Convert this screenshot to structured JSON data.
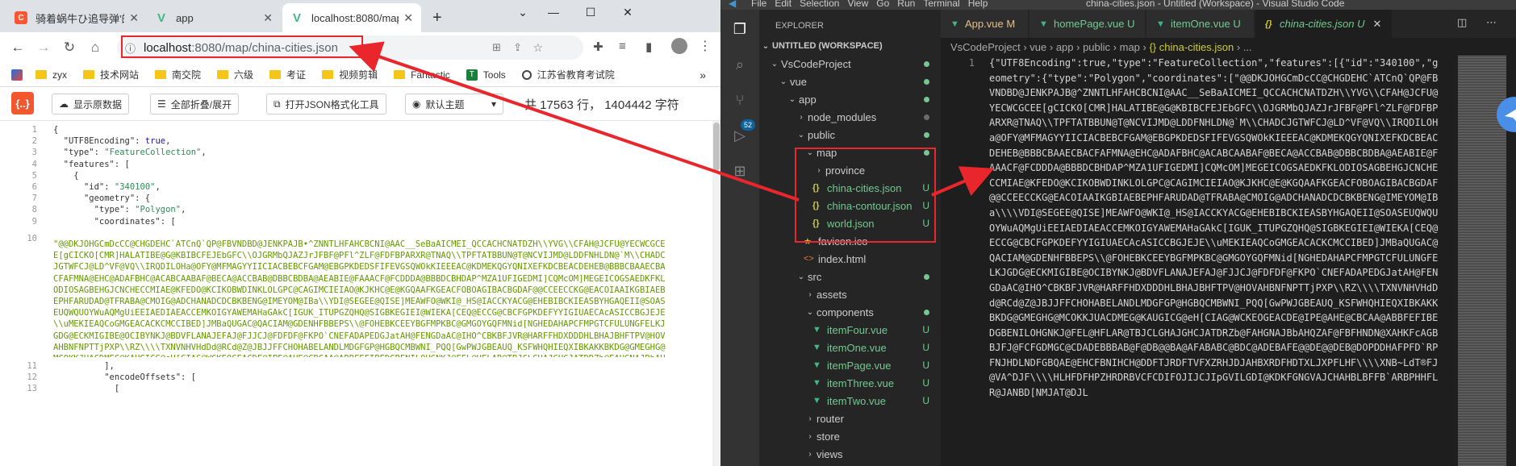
{
  "browser": {
    "tabs": [
      {
        "label": "骑着蜗牛ひ追导弹'的博客"
      },
      {
        "label": "app"
      },
      {
        "label": "localhost:8080/map/chin"
      }
    ],
    "new_tab": "+",
    "url": {
      "host": "localhost",
      "path": ":8080/map/china-cities.json"
    },
    "bookmarks": [
      "zyx",
      "技术网站",
      "南交院",
      "六级",
      "考证",
      "视频剪辑",
      "Fantastic",
      "Tools",
      "江苏省教育考试院"
    ],
    "more_bookmarks": "»",
    "colors": {
      "tabbar": "#dee1e6",
      "bookmark_folder": "#f5c518",
      "tool_logo": "#f2572d"
    }
  },
  "json_tool": {
    "logo": "{..}",
    "buttons": {
      "raw": "显示原数据",
      "fold": "全部折叠/展开",
      "format": "打开JSON格式化工具",
      "theme": "默认主题"
    },
    "stats": "共 17563 行， 1404442 字符"
  },
  "json_view": {
    "line_numbers": [
      "1",
      "2",
      "3",
      "4",
      "5",
      "6",
      "7",
      "8",
      "9",
      "10",
      "11",
      "12",
      "13"
    ],
    "lines": [
      "{",
      "  \"UTF8Encoding\": true,",
      "  \"type\": \"FeatureCollection\",",
      "  \"features\": [",
      "    {",
      "      \"id\": \"340100\",",
      "      \"geometry\": {",
      "        \"type\": \"Polygon\",",
      "        \"coordinates\": [",
      "          ],",
      "          \"encodeOffsets\": [",
      "            ["
    ],
    "big_string": "\"@@DKJOHGCmDcCC@CHGDEHC`ATCnQ`QP@FBVNDBD@JENKPAJB•^ZNNTLHFAHCBCNI@AAC__SeBaAICMEI_QCCACHCNATDZH\\\\YVG\\\\CFAH@JCFU@YECWCGCEE[gCICKO[CMR]HALATIBE@G@KBIBCFEJEbGFC\\\\OJGRMbQJAZJrJFBF@PFl^ZLF@FDFBPARXR@TNAQ\\\\TPFTATBBUN@T@NCVIJMD@LDDFNHLDN@`M\\\\CHADCJGTWFCJ@LD^VF@VQ\\\\IRQDILOHa@OFY@MFMAGYYIICIACBEBCFGAM@EBGPKDEDSFIFEVGSQWOkKIEEEAC@KDMEKQGYQNIXEFKDCBEACDEHEB@BBBCBAAECBACFAFMNA@EHC@ADAFBHC@ACABCAABAF@BECA@ACCBAB@DBBCBDBA@AEABIE@FAAACF@FCDDDA@BBBDCBHDAP^MZA1UFIGEDMI]CQMcOM]MEGEICOGSAEDKFKLODIOSAGBEHGJCNCHECCMIAE@KFEDO@KCIKOBWDINKLOLGPC@CAGIMCIEIAO@KJKHC@E@KGQAAFKGEACFOBOAGIBACBGDAF@@CCEECCKG@EACOIAAIKGBIAEBEPHFARUDAD@TFRABA@CMOIG@ADCHANADCDCBKBENG@IMEYOM@IBa\\\\YDI@SEGEE@QISE]MEAWFO@WKI@_HS@IACCKYACG@EHEBIBCKIEASBYHGAQEII@SOASEUQWQUOYWuAQMgUiEEIAEDIAEACCEMKOIGYAWEMAHaGAkC[IGUK_ITUPGZQHQ@SIGBKEGIEI@WIEKA[CEQ@ECCG@CBCFGPKDEFYYIGIUAECAcASICCBGJEJE\\\\uMEKIEAQCoGMGEACACKCMCCIBED]JMBaQUGAC@QACIAM@GDENHFBBEPS\\\\@FOHEBKCEEYBGFMPKBC@GMGOYGQFMNid[NGHEDAHAPCFMPGTCFULUNGFELKJGDG@ECKMIGIBE@OCIBYNKJ@BDVFLANAJEFAJ@FJJCJ@FDFDF@FKPO`CNEFADAPEDGJatAH@FENGDaAC@IHO^CBKBFJVR@HARFFHDXDDDHLBHAJBHFTPV@HOVAHBNFNPTTjPXP\\\\RZ\\\\\\\\TXNVNHVHdDd@RCd@Z@JBJJFFCHOHABELANDLMDGFGP@HGBQCMBWNI_PQQ[GwPWJGBEAUQ_KSFWHQHIEQXIBKAKKBKDG@GMEGHG@MCOKKJUACDMEG@KAUGICG@eH[CIAG@WCKEOGEACDE@IPE@AHE@CBCAA@ABBFEFIBEDGBENILOHGNKJ@FEL@HFLAR@TBJCLGHAJGHCJATDRZb@FAHGNAJBbAHQZAF@FBFHNDN@XAHKFcAGBBJFJ@FCFGDMGC@CDADEBBBAB@F@DB@@BA@AFABABC@BDC@ADEBAFE@@DE@@DEB@DOPDDHAFPFD`RPFNJHDLNDFGBQAE@EHCFBNIHCH@DDFTJRDFTVFXZRHJDJAHBXRDFHDTXLJXPFLHF\\\\\\\\XNB~LdT®FJ@VA^DJF\\\\\\\\HLHFDFHPZHRDRBVCFCDIFOJIJCJIpGVILGDI@KDKFGNGVAJCHAHBLBFFB`ARBPHHFLR@JANBD[NMJAT@DJLJF1@L@NDJFPNDFDJF\\\\\\\\HLBHCTEHCFGDEAWOC@E@EJCRAJFPNPDTHDLNDFADKDCAEC@GKTJFBF@TDXBHAVEBOCUAKB[FFF@HBJAHDFLBJHHDFDHBH@FBD@DH@DBBBAFH@FDDAHDDCFBBDDDFDBBFFDRTHRCB@JA@@PFHBDDBBD@NBBFFBREHEBBJBDRL@DH@LDDEF@BBDCB@DDLEJKLFL@DCH@FCFADBD@PLFJDFDBRAFBTB@ED@H@\"",
    "colors": {
      "string": "#669900",
      "key": "#333333",
      "boolean": "#1a1aa6",
      "value_string": "#2e8b57"
    }
  },
  "vscode": {
    "title": "china-cities.json - Untitled (Workspace) - Visual Studio Code",
    "menu": [
      "File",
      "Edit",
      "Selection",
      "View",
      "Go",
      "Run",
      "Terminal",
      "Help"
    ],
    "scm_badge": "52",
    "explorer_title": "EXPLORER",
    "workspace": "UNTITLED (WORKSPACE)",
    "tree": [
      {
        "label": "VsCodeProject",
        "depth": 1,
        "kind": "folder",
        "open": true
      },
      {
        "label": "vue",
        "depth": 2,
        "kind": "folder",
        "open": true
      },
      {
        "label": "app",
        "depth": 3,
        "kind": "folder",
        "open": true
      },
      {
        "label": "node_modules",
        "depth": 4,
        "kind": "folder",
        "open": false
      },
      {
        "label": "public",
        "depth": 4,
        "kind": "folder",
        "open": true
      },
      {
        "label": "map",
        "depth": 5,
        "kind": "folder",
        "open": true
      },
      {
        "label": "province",
        "depth": 6,
        "kind": "folder",
        "open": false
      },
      {
        "label": "china-cities.json",
        "depth": 6,
        "kind": "json",
        "flag": "U"
      },
      {
        "label": "china-contour.json",
        "depth": 6,
        "kind": "json",
        "flag": "U"
      },
      {
        "label": "world.json",
        "depth": 6,
        "kind": "json",
        "flag": "U"
      },
      {
        "label": "favicon.ico",
        "depth": 5,
        "kind": "ico"
      },
      {
        "label": "index.html",
        "depth": 5,
        "kind": "html"
      },
      {
        "label": "src",
        "depth": 4,
        "kind": "folder",
        "open": true
      },
      {
        "label": "assets",
        "depth": 5,
        "kind": "folder",
        "open": false
      },
      {
        "label": "components",
        "depth": 5,
        "kind": "folder",
        "open": true
      },
      {
        "label": "itemFour.vue",
        "depth": 6,
        "kind": "vue",
        "flag": "U"
      },
      {
        "label": "itemOne.vue",
        "depth": 6,
        "kind": "vue",
        "flag": "U"
      },
      {
        "label": "itemPage.vue",
        "depth": 6,
        "kind": "vue",
        "flag": "U"
      },
      {
        "label": "itemThree.vue",
        "depth": 6,
        "kind": "vue",
        "flag": "U"
      },
      {
        "label": "itemTwo.vue",
        "depth": 6,
        "kind": "vue",
        "flag": "U"
      },
      {
        "label": "router",
        "depth": 5,
        "kind": "folder",
        "open": false
      },
      {
        "label": "store",
        "depth": 5,
        "kind": "folder",
        "open": false
      },
      {
        "label": "views",
        "depth": 5,
        "kind": "folder",
        "open": false
      }
    ],
    "editor_tabs": [
      {
        "label": "App.vue",
        "flag": "M",
        "icon": "vue"
      },
      {
        "label": "homePage.vue",
        "flag": "U",
        "icon": "vue"
      },
      {
        "label": "itemOne.vue",
        "flag": "U",
        "icon": "vue"
      },
      {
        "label": "china-cities.json",
        "flag": "U",
        "icon": "json",
        "active": true
      }
    ],
    "breadcrumb": [
      "VsCodeProject",
      "vue",
      "app",
      "public",
      "map",
      "{} china-cities.json",
      "..."
    ],
    "line_number": "1",
    "code": "{\"UTF8Encoding\":true,\"type\":\"FeatureCollection\",\"features\":[{\"id\":\"340100\",\"geometry\":{\"type\":\"Polygon\",\"coordinates\":[\"@@DKJOHGCmDcCC@CHGDEHC`ATCnQ`QP@FBVNDBD@JENKPAJB@^ZNNTLHFAHCBCNI@AAC__SeBaAICMEI_QCCACHCNATDZH\\\\YVG\\\\CFAH@JCFU@YECWCGCEE[gCICKO[CMR]HALATIBE@G@KBIBCFEJEbGFC\\\\OJGRMbQJAZJrJFBF@PFl^ZLF@FDFBPARXR@TNAQ\\\\TPFTATBBUN@T@NCVIJMD@LDDFNHLDN@`M\\\\CHADCJGTWFCJ@LD^VF@VQ\\\\IRQDILOHa@OFY@MFMAGYYIICIACBEBCFGAM@EBGPKDEDSFIFEVGSQWOkKIEEEAC@KDMEKQGYQNIXEFKDCBEACDEHEB@BBBCBAAECBACFAFMNA@EHC@ADAFBHC@ACABCAABAF@BECA@ACCBAB@DBBCBDBA@AEABIE@FAAACF@FCDDDA@BBBDCBHDAP^MZA1UFIGEDMI]CQMcOM]MEGEICOGSAEDKFKLODIOSAGBEHGJCNCHECCMIAE@KFEDO@KCIKOBWDINKLOLGPC@CAGIMCIEIAO@KJKHC@E@KGQAAFKGEACFOBOAGIBACBGDAF@@CCEECCKG@EACOIAAIKGBIAEBEPHFARUDAD@TFRABA@CMOIG@ADCHANADCDCBKBENG@IMEYOM@IBa\\\\\\\\VDI@SEGEE@QISE]MEAWFO@WKI@_HS@IACCKYACG@EHEBIBCKIEASBYHGAQEII@SOASEUQWQUOYWuAQMgUiEEIAEDIAEACCEMKOIGYAWEMAHaGAkC[IGUK_ITUPGZQHQ@SIGBKEGIEI@WIEKA[CEQ@ECCG@CBCFGPKDEFYYIGIUAECAcASICCBGJEJE\\\\uMEKIEAQCoGMGEACACKCMCCIBED]JMBaQUGAC@QACIAM@GDENHFBBEPS\\\\@FOHEBKCEEYBGFMPKBC@GMGOYGQFMNid[NGHEDAHAPCFMPGTCFULUNGFELKJGDG@ECKMIGIBE@OCIBYNKJ@BDVFLANAJEFAJ@FJJCJ@FDFDF@FKPO`CNEFADAPEDGJatAH@FENGDaAC@IHO^CBKBFJVR@HARFFHDXDDDHLBHAJBHFTPV@HOVAHBNFNPTTjPXP\\\\RZ\\\\\\\\TXNVNHVHdDd@RCd@Z@JBJJFFCHOHABELANDLMDGFGP@HGBQCMBWNI_PQQ[GwPWJGBEAUQ_KSFWHQHIEQXIBKAKKBKDG@GMEGHG@MCOKKJUACDMEG@KAUGICG@eH[CIAG@WCKEOGEACDE@IPE@AHE@CBCAA@ABBFEFIBEDGBENILOHGNKJ@FEL@HFLAR@TBJCLGHAJGHCJATDRZb@FAHGNAJBbAHQZAF@FBFHNDN@XAHKFcAGBBJFJ@FCFGDMGC@CDADEBBBAB@F@DB@@BA@AFABABC@BDC@ADEBAFE@@DE@@DEB@DOPDDHAFPFD`RPFNJHDLNDFGBQAE@EHCFBNIHCH@DDFTJRDFTVFXZRHJDJAHBXRDFHDTXLJXPFLHF\\\\\\\\XNB~LdT®FJ@VA^DJF\\\\\\\\HLHFDFHPZHRDRBVCFCDIFOJIJCJIpGVILGDI@KDKFGNGVAJCHAHBLBFFB`ARBPHHFLR@JANBD[NMJAT@DJL",
    "colors": {
      "bg": "#1e1e1e",
      "sidebar": "#252526",
      "activity": "#333333",
      "untracked": "#73c991",
      "accent": "#0e639c"
    }
  },
  "annotation": {
    "color": "#e8262b"
  }
}
